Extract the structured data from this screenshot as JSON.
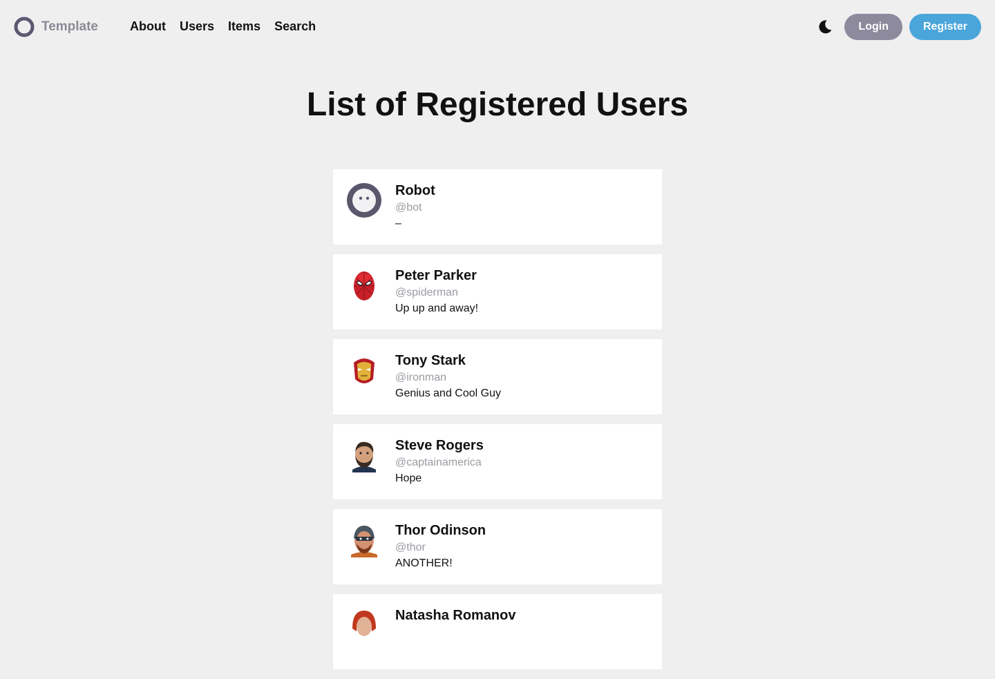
{
  "brand": {
    "name": "Template",
    "logo_icon": "ring-logo-icon"
  },
  "nav": {
    "links": [
      "About",
      "Users",
      "Items",
      "Search"
    ],
    "theme_icon": "moon-icon",
    "login_label": "Login",
    "register_label": "Register"
  },
  "colors": {
    "background": "#efeff0",
    "brand_text": "#8a8a96",
    "login_button": "#8c8a9c",
    "register_button": "#4aa5db",
    "handle_text": "#9a9aa2"
  },
  "page": {
    "title": "List of Registered Users"
  },
  "users": [
    {
      "name": "Robot",
      "handle": "@bot",
      "bio": "–",
      "avatar": "robot-face-icon"
    },
    {
      "name": "Peter Parker",
      "handle": "@spiderman",
      "bio": "Up up and away!",
      "avatar": "spiderman-avatar"
    },
    {
      "name": "Tony Stark",
      "handle": "@ironman",
      "bio": "Genius and Cool Guy",
      "avatar": "ironman-avatar"
    },
    {
      "name": "Steve Rogers",
      "handle": "@captainamerica",
      "bio": "Hope",
      "avatar": "captain-america-avatar"
    },
    {
      "name": "Thor Odinson",
      "handle": "@thor",
      "bio": "ANOTHER!",
      "avatar": "thor-avatar"
    },
    {
      "name": "Natasha Romanov",
      "handle": "",
      "bio": "",
      "avatar": "black-widow-avatar"
    }
  ]
}
